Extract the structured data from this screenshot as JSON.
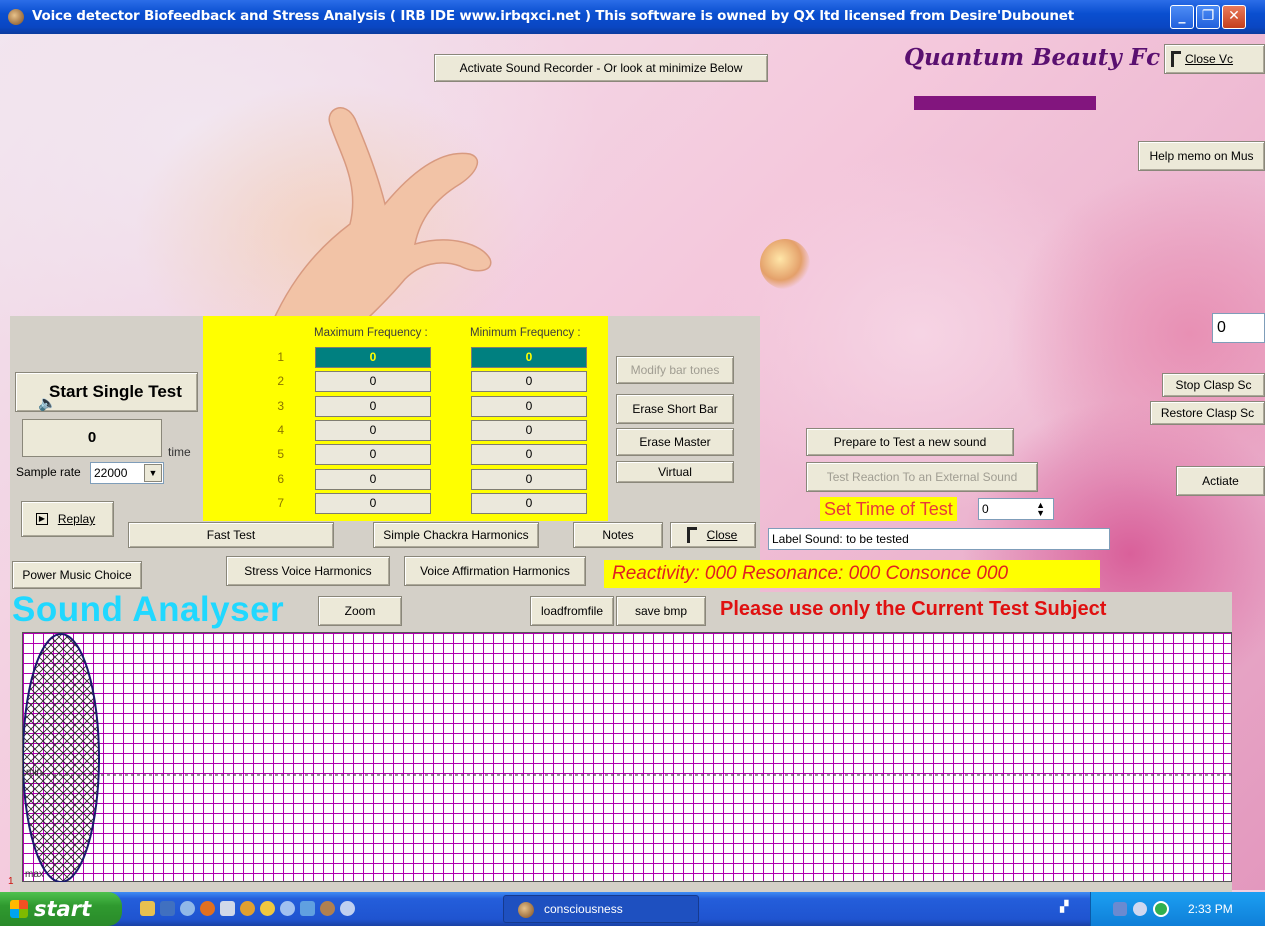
{
  "window": {
    "title": "Voice detector  Biofeedback and Stress Analysis   ( IRB IDE  www.irbqxci.net )   This software is owned by QX ltd licensed from Desire'Dubounet"
  },
  "header": {
    "activate_recorder": "Activate Sound Recorder  - Or look at minimize Below",
    "brand": "Quantum Beauty Fc",
    "close_label": "Close Vc",
    "help_memo": "Help memo on Mus",
    "right_input_value": "0",
    "stop_clasp": "Stop Clasp Sc",
    "restore_clasp": "Restore Clasp Sc",
    "activate_right": "Actiate"
  },
  "panel": {
    "start_single_test": "Start Single Test",
    "counter_value": "0",
    "time_label": "time",
    "sample_rate_label": "Sample rate",
    "sample_rate_value": "22000",
    "replay": "Replay",
    "max_freq_header": "Maximum Frequency :",
    "min_freq_header": "Minimum Frequency :",
    "rows": [
      {
        "n": "1",
        "max": "0",
        "min": "0"
      },
      {
        "n": "2",
        "max": "0",
        "min": "0"
      },
      {
        "n": "3",
        "max": "0",
        "min": "0"
      },
      {
        "n": "4",
        "max": "0",
        "min": "0"
      },
      {
        "n": "5",
        "max": "0",
        "min": "0"
      },
      {
        "n": "6",
        "max": "0",
        "min": "0"
      },
      {
        "n": "7",
        "max": "0",
        "min": "0"
      }
    ],
    "modify_bar_tones": "Modify bar tones",
    "erase_short_bar": "Erase Short Bar",
    "erase_master": "Erase Master",
    "virtual": "Virtual",
    "fast_test": "Fast Test",
    "simple_chackra": "Simple Chackra Harmonics",
    "notes": "Notes",
    "close": "Close",
    "power_music": "Power Music Choice",
    "stress_voice": "Stress Voice Harmonics",
    "voice_affirmation": "Voice Affirmation Harmonics"
  },
  "test_area": {
    "prepare": "Prepare to Test a new sound",
    "test_reaction": "Test Reaction To an External Sound",
    "set_time_label": "Set Time of Test",
    "set_time_value": "0",
    "label_sound": "Label Sound: to be tested",
    "reactivity": "Reactivity: 000  Resonance:  000  Consonce 000"
  },
  "analyser": {
    "title": "Sound Analyser",
    "zoom": "Zoom",
    "load": "loadfromfile",
    "save": "save bmp",
    "notice": "Please use only the Current Test Subject",
    "label_min": "min",
    "label_max": "max",
    "row_marker": "1"
  },
  "taskbar": {
    "start": "start",
    "task": "consciousness",
    "clock": "2:33 PM"
  },
  "colors": {
    "titlebar": "#0a4fd0",
    "panel_yellow": "#ffff00",
    "grid_line": "#b000b0",
    "analyser_title": "#20d8ff",
    "notice": "#e01010",
    "brand": "#5a1070"
  }
}
